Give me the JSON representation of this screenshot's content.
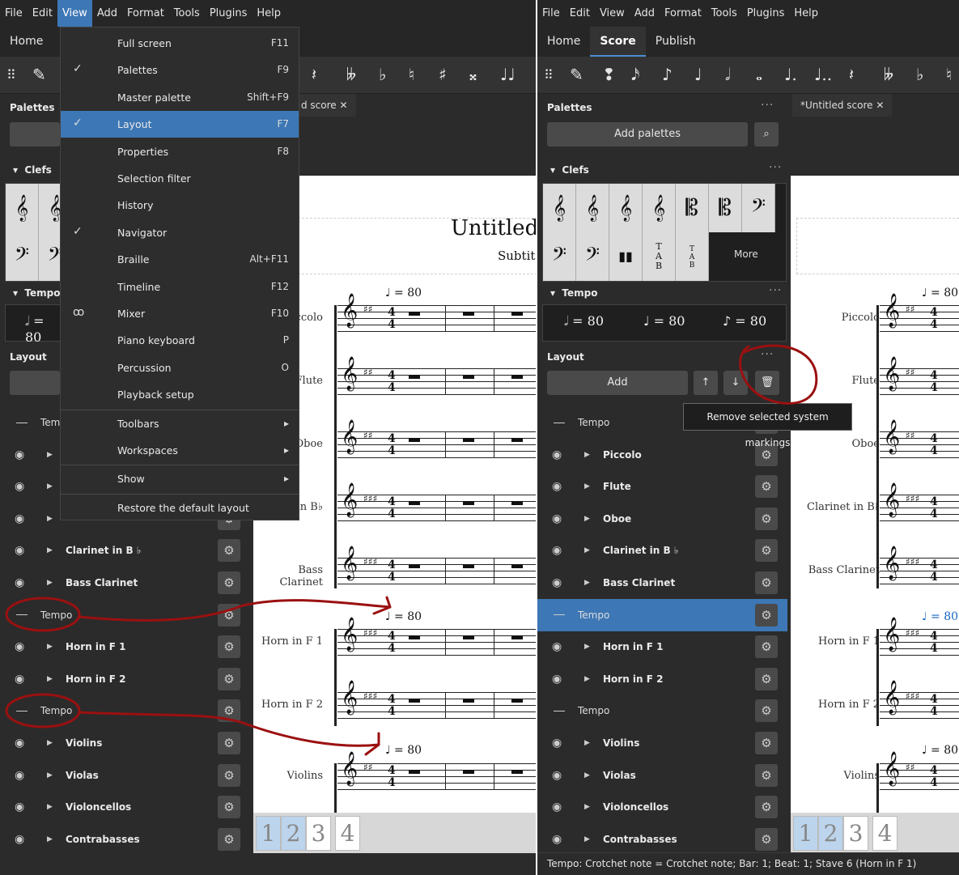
{
  "menubar": [
    "File",
    "Edit",
    "View",
    "Add",
    "Format",
    "Tools",
    "Plugins",
    "Help"
  ],
  "tabs": [
    "Home",
    "Score",
    "Publish"
  ],
  "panels": {
    "palettes_title": "Palettes",
    "add_palettes": "Add palettes",
    "clefs": "Clefs",
    "tempo": "Tempo",
    "more": "More",
    "tempo_items": [
      "𝅗𝅥 = 80",
      "♩ = 80",
      "♪ = 80"
    ],
    "layout_title": "Layout",
    "add": "Add"
  },
  "score_tab": "*Untitled score",
  "score_tab_left": "d score",
  "score": {
    "title_partial": "Untitled",
    "subtitle_partial": "Subtit",
    "tempo_mark": "♩ = 80",
    "time_sig_top": "4",
    "time_sig_bottom": "4"
  },
  "instruments_left": [
    "Piccolo",
    "Flute",
    "Oboe",
    "in B♭",
    "Bass Clarinet",
    "Horn in F 1",
    "Horn in F 2",
    "Violins"
  ],
  "instruments_right": [
    "Piccolo",
    "Flute",
    "Oboe",
    "Clarinet in B♭",
    "Bass Clarinet",
    "Horn in F 1",
    "Horn in F 2",
    "Violins"
  ],
  "layout_rows": [
    {
      "type": "tempo",
      "label": "Tempo"
    },
    {
      "type": "inst",
      "label": "Piccolo"
    },
    {
      "type": "inst",
      "label": "Flute"
    },
    {
      "type": "inst",
      "label": "Oboe"
    },
    {
      "type": "inst",
      "label": "Clarinet in B ♭"
    },
    {
      "type": "inst",
      "label": "Bass Clarinet"
    },
    {
      "type": "tempo",
      "label": "Tempo"
    },
    {
      "type": "inst",
      "label": "Horn in F 1"
    },
    {
      "type": "inst",
      "label": "Horn in F 2"
    },
    {
      "type": "tempo",
      "label": "Tempo"
    },
    {
      "type": "inst",
      "label": "Violins"
    },
    {
      "type": "inst",
      "label": "Violas"
    },
    {
      "type": "inst",
      "label": "Violoncellos"
    },
    {
      "type": "inst",
      "label": "Contrabasses"
    }
  ],
  "left_partial": {
    "tem": "Tem",
    "tempo_80": "𝅗𝅥 = 80"
  },
  "view_menu": [
    {
      "label": "Full screen",
      "shortcut": "F11",
      "check": ""
    },
    {
      "label": "Palettes",
      "shortcut": "F9",
      "check": "✓"
    },
    {
      "label": "Master palette",
      "shortcut": "Shift+F9",
      "check": ""
    },
    {
      "label": "Layout",
      "shortcut": "F7",
      "check": "✓"
    },
    {
      "label": "Properties",
      "shortcut": "F8",
      "check": ""
    },
    {
      "label": "Selection filter",
      "shortcut": "",
      "check": ""
    },
    {
      "label": "History",
      "shortcut": "",
      "check": ""
    },
    {
      "label": "Navigator",
      "shortcut": "",
      "check": "✓"
    },
    {
      "label": "Braille",
      "shortcut": "Alt+F11",
      "check": ""
    },
    {
      "label": "Timeline",
      "shortcut": "F12",
      "check": ""
    },
    {
      "label": "Mixer",
      "shortcut": "F10",
      "check": "ꝏ"
    },
    {
      "label": "Piano keyboard",
      "shortcut": "P",
      "check": ""
    },
    {
      "label": "Percussion",
      "shortcut": "O",
      "check": ""
    },
    {
      "label": "Playback setup",
      "shortcut": "",
      "check": ""
    },
    {
      "label": "Toolbars",
      "shortcut": "▸",
      "check": ""
    },
    {
      "label": "Workspaces",
      "shortcut": "▸",
      "check": ""
    },
    {
      "label": "Show",
      "shortcut": "▸",
      "check": ""
    },
    {
      "label": "Restore the default layout",
      "shortcut": "",
      "check": ""
    }
  ],
  "pages": [
    "1",
    "2",
    "3",
    "4"
  ],
  "tooltip": "Remove selected system markings",
  "status": "Tempo: Crotchet note = Crotchet note; Bar: 1; Beat: 1; Stave 6 (Horn in F 1)",
  "colors": {
    "accent": "#3d77b5",
    "annotation": "#9b1010",
    "selected_tempo": "#1565c0"
  }
}
